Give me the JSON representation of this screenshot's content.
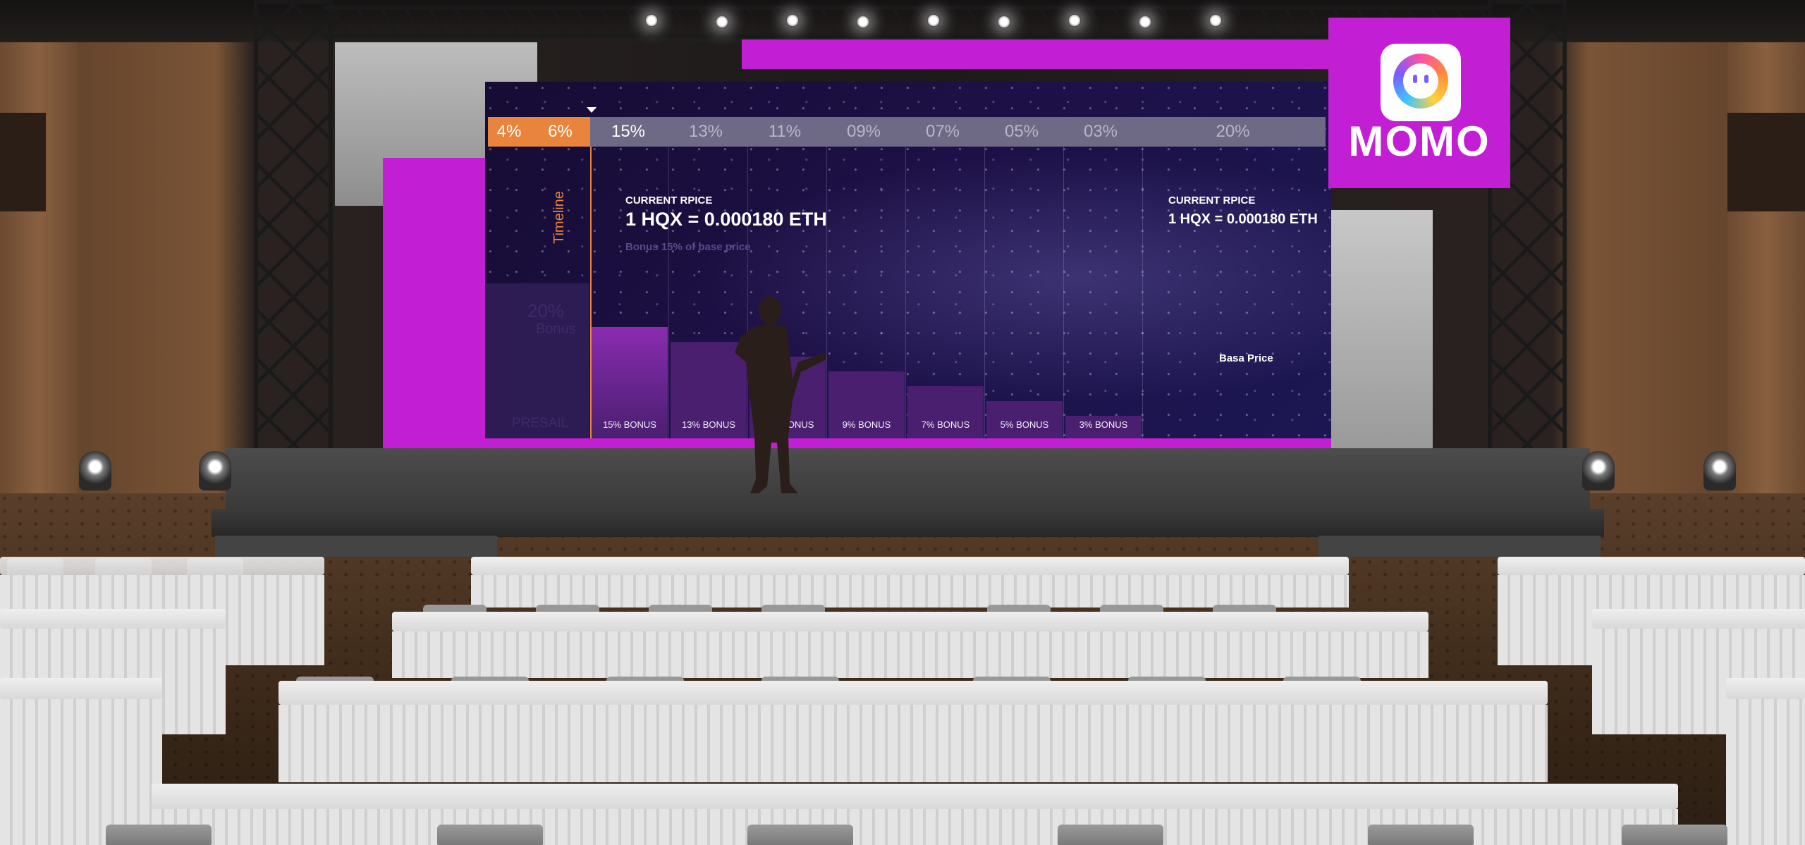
{
  "screen": {
    "tabs": [
      {
        "label": "4%",
        "style": "orange"
      },
      {
        "label": "6%",
        "style": "orange"
      },
      {
        "label": "15%",
        "style": "active"
      },
      {
        "label": "13%",
        "style": "gray"
      },
      {
        "label": "11%",
        "style": "gray"
      },
      {
        "label": "09%",
        "style": "gray"
      },
      {
        "label": "07%",
        "style": "gray"
      },
      {
        "label": "05%",
        "style": "gray"
      },
      {
        "label": "03%",
        "style": "gray"
      },
      {
        "label": "20%",
        "style": "gray"
      }
    ],
    "timeline_label": "Timeline",
    "presale": {
      "pct": "20%",
      "bonus": "Bonus",
      "label": "PRESAIL"
    },
    "current_price_left": {
      "caption": "CURRENT RPICE",
      "value": "1 HQX = 0.000180 ETH",
      "note": "Bonus 15% of base price"
    },
    "current_price_right": {
      "caption": "CURRENT RPICE",
      "value": "1 HQX = 0.000180 ETH"
    },
    "base_price_label": "Basa Price",
    "bars": [
      {
        "label": "15% BONUS",
        "bonus": 15
      },
      {
        "label": "13% BONUS",
        "bonus": 13
      },
      {
        "label": "11% BONUS",
        "bonus": 11
      },
      {
        "label": "9% BONUS",
        "bonus": 9
      },
      {
        "label": "7% BONUS",
        "bonus": 7
      },
      {
        "label": "5% BONUS",
        "bonus": 5
      },
      {
        "label": "3% BONUS",
        "bonus": 3
      }
    ],
    "colors": {
      "orange": "#e8843c",
      "tab_gray": "#6e6a86",
      "bar_purple": "#4a1f70",
      "bar_highlight": "#8a2bb0"
    }
  },
  "logo": {
    "text": "MOMO",
    "background": "#c21fd4"
  },
  "stage": {
    "accent": "#c21fd4"
  }
}
